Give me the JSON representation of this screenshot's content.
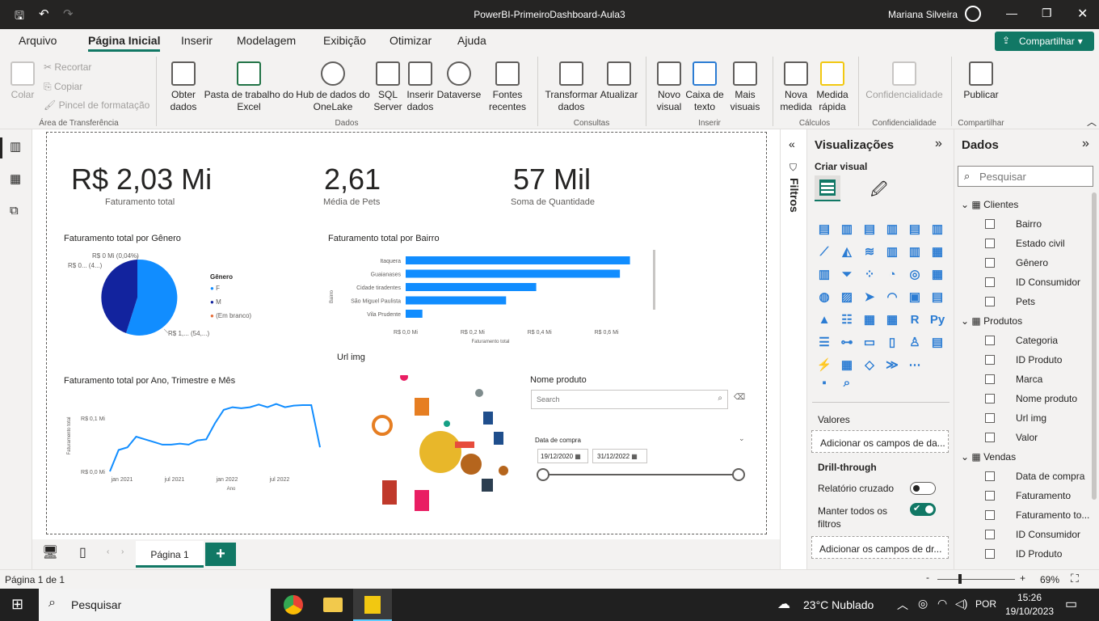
{
  "window": {
    "title": "PowerBI-PrimeiroDashboard-Aula3",
    "user": "Mariana Silveira"
  },
  "menu": {
    "tabs": [
      "Arquivo",
      "Página Inicial",
      "Inserir",
      "Modelagem",
      "Exibição",
      "Otimizar",
      "Ajuda"
    ],
    "share": "Compartilhar"
  },
  "ribbon": {
    "clipboard": {
      "paste": "Colar",
      "cut": "Recortar",
      "copy": "Copiar",
      "format": "Pincel de formatação",
      "group": "Área de Transferência"
    },
    "data": {
      "get_data": "Obter dados",
      "excel": "Pasta de trabalho do Excel",
      "onelake": "Hub de dados do OneLake",
      "sql": "SQL Server",
      "enter": "Inserir dados",
      "dataverse": "Dataverse",
      "recent": "Fontes recentes",
      "group": "Dados"
    },
    "queries": {
      "transform": "Transformar dados",
      "refresh": "Atualizar",
      "group": "Consultas"
    },
    "insert": {
      "visual": "Novo visual",
      "textbox": "Caixa de texto",
      "more": "Mais visuais",
      "group": "Inserir"
    },
    "calc": {
      "measure": "Nova medida",
      "quick": "Medida rápida",
      "group": "Cálculos"
    },
    "sens": {
      "label": "Confidencialidade",
      "group": "Confidencialidade"
    },
    "share": {
      "publish": "Publicar",
      "group": "Compartilhar"
    }
  },
  "kpis": [
    {
      "value": "R$ 2,03 Mi",
      "label": "Faturamento total"
    },
    {
      "value": "2,61",
      "label": "Média de Pets"
    },
    {
      "value": "57 Mil",
      "label": "Soma de Quantidade"
    }
  ],
  "pie": {
    "title": "Faturamento total por Gênero",
    "legend_title": "Gênero",
    "legend": [
      "F",
      "M",
      "(Em branco)"
    ],
    "labels": [
      "R$ 0 Mi (0,04%)",
      "R$ 0... (4...)",
      "R$ 1,... (54,...)"
    ]
  },
  "chart_data": [
    {
      "type": "pie",
      "title": "Faturamento total por Gênero",
      "categories": [
        "F",
        "M",
        "(Em branco)"
      ],
      "values": [
        54,
        46,
        0.04
      ],
      "colors": [
        "#118dff",
        "#12239e",
        "#e66c37"
      ]
    },
    {
      "type": "bar",
      "title": "Faturamento total por Bairro",
      "categories": [
        "Itaquera",
        "Guaianases",
        "Cidade tiradentes",
        "São Miguel Paulista",
        "Vila Prudente"
      ],
      "values": [
        0.67,
        0.64,
        0.39,
        0.3,
        0.05
      ],
      "xlabel": "Faturamento total",
      "ylabel": "Bairro",
      "xticks": [
        "R$ 0,0 Mi",
        "R$ 0,2 Mi",
        "R$ 0,4 Mi",
        "R$ 0,6 Mi"
      ],
      "xlim": [
        0,
        0.7
      ],
      "color": "#118dff"
    },
    {
      "type": "line",
      "title": "Faturamento total por Ano, Trimestre e Mês",
      "xlabel": "Ano",
      "ylabel": "Faturamento total",
      "xticks": [
        "jan 2021",
        "jul 2021",
        "jan 2022",
        "jul 2022"
      ],
      "yticks": [
        "R$ 0,1 Mi",
        "R$ 0,0 Mi"
      ],
      "ylim": [
        0,
        0.13
      ],
      "values": [
        0.0,
        0.04,
        0.045,
        0.065,
        0.06,
        0.055,
        0.05,
        0.05,
        0.052,
        0.05,
        0.058,
        0.06,
        0.09,
        0.115,
        0.12,
        0.118,
        0.12,
        0.125,
        0.12,
        0.126,
        0.12,
        0.123,
        0.124,
        0.124,
        0.045
      ],
      "color": "#118dff"
    }
  ],
  "bar": {
    "title": "Faturamento total por Bairro"
  },
  "line": {
    "title": "Faturamento total por Ano, Trimestre e Mês"
  },
  "image": {
    "title": "Url img"
  },
  "slicer": {
    "title": "Nome produto",
    "placeholder": "Search",
    "date_title": "Data de compra",
    "date_from": "19/12/2020",
    "date_to": "31/12/2022"
  },
  "filters": {
    "label": "Filtros"
  },
  "viz": {
    "title": "Visualizações",
    "create": "Criar visual",
    "values": "Valores",
    "add_fields": "Adicionar os campos de da...",
    "drill": "Drill-through",
    "cross": "Relatório cruzado",
    "keep": "Manter todos os filtros",
    "add_drill": "Adicionar os campos de dr..."
  },
  "dados": {
    "title": "Dados",
    "search": "Pesquisar",
    "tables": [
      {
        "name": "Clientes",
        "fields": [
          "Bairro",
          "Estado civil",
          "Gênero",
          "ID Consumidor",
          "Pets"
        ]
      },
      {
        "name": "Produtos",
        "fields": [
          "Categoria",
          "ID Produto",
          "Marca",
          "Nome produto",
          "Url img",
          "Valor"
        ]
      },
      {
        "name": "Vendas",
        "fields": [
          "Data de compra",
          "Faturamento",
          "Faturamento to...",
          "ID Consumidor",
          "ID Produto"
        ]
      }
    ]
  },
  "pages": {
    "page1": "Página 1",
    "status": "Página 1 de 1",
    "zoom": "69%"
  },
  "taskbar": {
    "search": "Pesquisar",
    "weather": "23°C  Nublado",
    "lang": "POR",
    "time": "15:26",
    "date": "19/10/2023"
  }
}
